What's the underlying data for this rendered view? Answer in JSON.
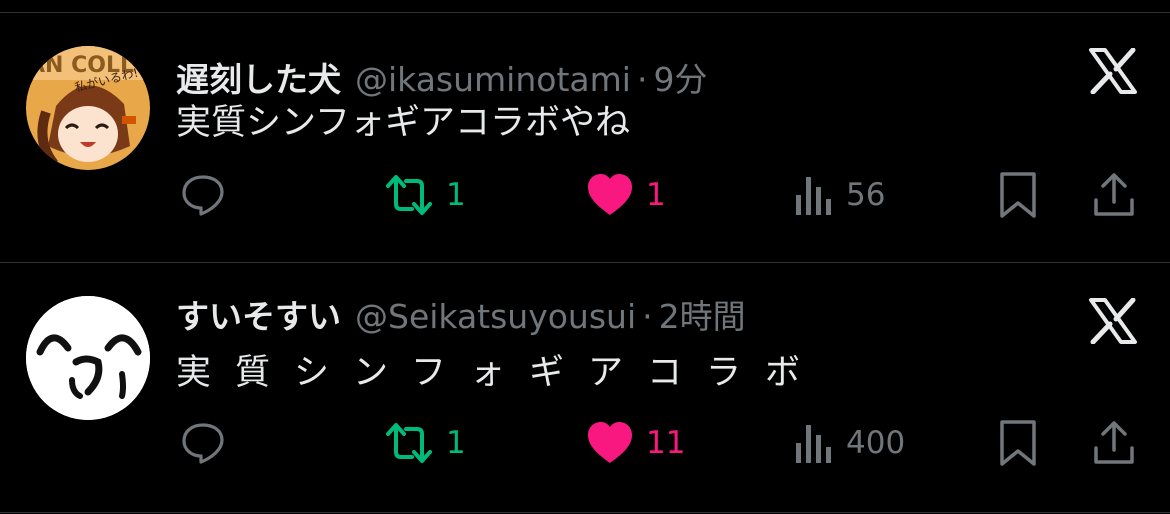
{
  "colors": {
    "background": "#000000",
    "text_primary": "#e7e9ea",
    "text_secondary": "#71767b",
    "divider": "#2f3336",
    "retweet_active": "#00ba7c",
    "like_active": "#f91880"
  },
  "tweets": [
    {
      "display_name": "遅刻した犬",
      "handle": "@ikasuminotami",
      "separator": "·",
      "time": "9分",
      "text": "実質シンフォギアコラボやね",
      "retweets": "1",
      "likes": "1",
      "views": "56",
      "avatar_text": "私がいるわ!",
      "avatar_banner": "AN COLL",
      "icons": [
        "reply-icon",
        "retweet-icon",
        "like-icon",
        "views-icon",
        "bookmark-icon",
        "share-icon",
        "x-logo-icon"
      ]
    },
    {
      "display_name": "すいそすい",
      "handle": "@Seikatsuyousui",
      "separator": "·",
      "time": "2時間",
      "text": "実質シンフォギアコラボ",
      "retweets": "1",
      "likes": "11",
      "views": "400",
      "icons": [
        "reply-icon",
        "retweet-icon",
        "like-icon",
        "views-icon",
        "bookmark-icon",
        "share-icon",
        "x-logo-icon"
      ]
    }
  ]
}
